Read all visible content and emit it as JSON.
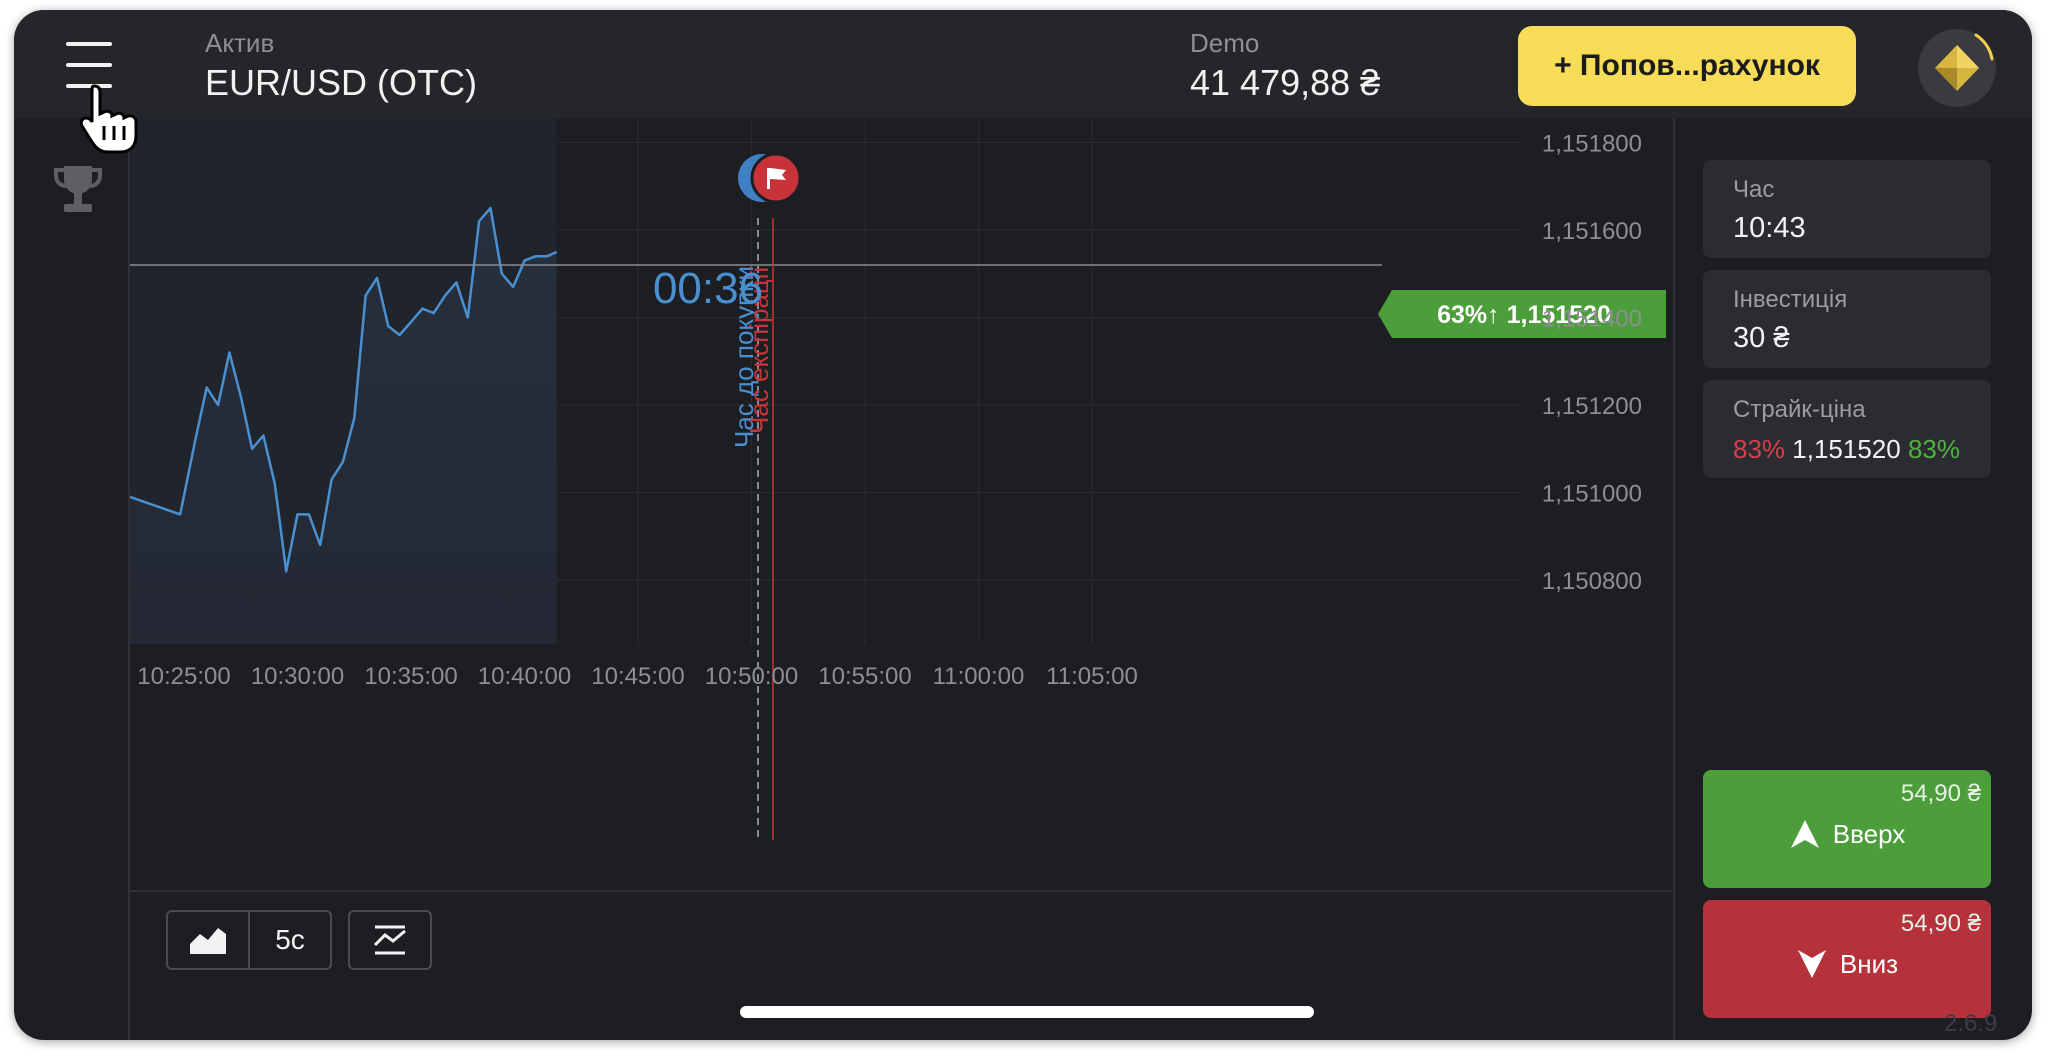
{
  "header": {
    "asset_label": "Актив",
    "asset_name": "EUR/USD (OTC)",
    "account_label": "Demo",
    "balance": "41 479,88 ₴",
    "deposit_label": "+ Попов...рахунок"
  },
  "chart": {
    "timer": "00:36",
    "purchase_time_label": "Час до покупки",
    "expiry_time_label": "Час експірації",
    "current_price_badge": "63%↑ 1,151520",
    "y_ticks": [
      "1,151800",
      "1,151600",
      "1,151400",
      "1,151200",
      "1,151000",
      "1,150800"
    ],
    "x_ticks": [
      "10:25:00",
      "10:30:00",
      "10:35:00",
      "10:40:00",
      "10:45:00",
      "10:50:00",
      "10:55:00",
      "11:00:00",
      "11:05:00"
    ]
  },
  "panel": {
    "time_label": "Час",
    "time_value": "10:43",
    "investment_label": "Інвестиція",
    "investment_value": "30 ₴",
    "strike_label": "Страйк-ціна",
    "strike_down_pct": "83%",
    "strike_price": "1,151520",
    "strike_up_pct": "83%",
    "up_amount": "54,90 ₴",
    "up_label": "Вверх",
    "down_amount": "54,90 ₴",
    "down_label": "Вниз"
  },
  "toolbar": {
    "timeframe_label": "5с"
  },
  "version": "2.6.9",
  "colors": {
    "background": "#1d1e22",
    "accent_yellow": "#f6dc57",
    "up_green": "#4c9e3a",
    "down_red": "#b5323a",
    "line_blue": "#4a90d0"
  },
  "icons": [
    "menu-icon",
    "trophy-icon",
    "area-chart-icon",
    "indicators-icon",
    "arrow-up-icon",
    "arrow-down-icon",
    "flag-icon",
    "diamond-icon",
    "hand-cursor-icon"
  ],
  "chart_data": {
    "type": "line",
    "title": "",
    "xlabel": "",
    "ylabel": "",
    "x_range": [
      "10:24:05",
      "11:08:15"
    ],
    "ylim": [
      1.15062,
      1.15193
    ],
    "grid": true,
    "current_price": 1.15152,
    "series": [
      {
        "x": [
          "10:24:10",
          "10:24:50",
          "10:25:30",
          "10:26:00",
          "10:26:30",
          "10:27:00",
          "10:27:30",
          "10:28:00",
          "10:28:30",
          "10:29:00",
          "10:29:30",
          "10:30:00",
          "10:30:30",
          "10:31:00",
          "10:31:30",
          "10:32:00",
          "10:32:30",
          "10:33:00",
          "10:33:30",
          "10:34:00",
          "10:34:30",
          "10:35:00",
          "10:35:30",
          "10:36:00",
          "10:36:30",
          "10:37:00",
          "10:37:30",
          "10:38:00",
          "10:38:30",
          "10:39:00",
          "10:39:30",
          "10:40:00",
          "10:40:30",
          "10:41:00",
          "10:41:25"
        ],
        "y": [
          1.15099,
          1.15095,
          1.15112,
          1.15124,
          1.1512,
          1.15132,
          1.15122,
          1.1511,
          1.15113,
          1.15102,
          1.15082,
          1.15095,
          1.15095,
          1.15088,
          1.15103,
          1.15107,
          1.15117,
          1.15145,
          1.15149,
          1.15138,
          1.15136,
          1.15139,
          1.15142,
          1.15141,
          1.15145,
          1.15148,
          1.1514,
          1.15162,
          1.15165,
          1.1515,
          1.15147,
          1.15153,
          1.15154,
          1.15154,
          1.15155
        ]
      }
    ]
  }
}
